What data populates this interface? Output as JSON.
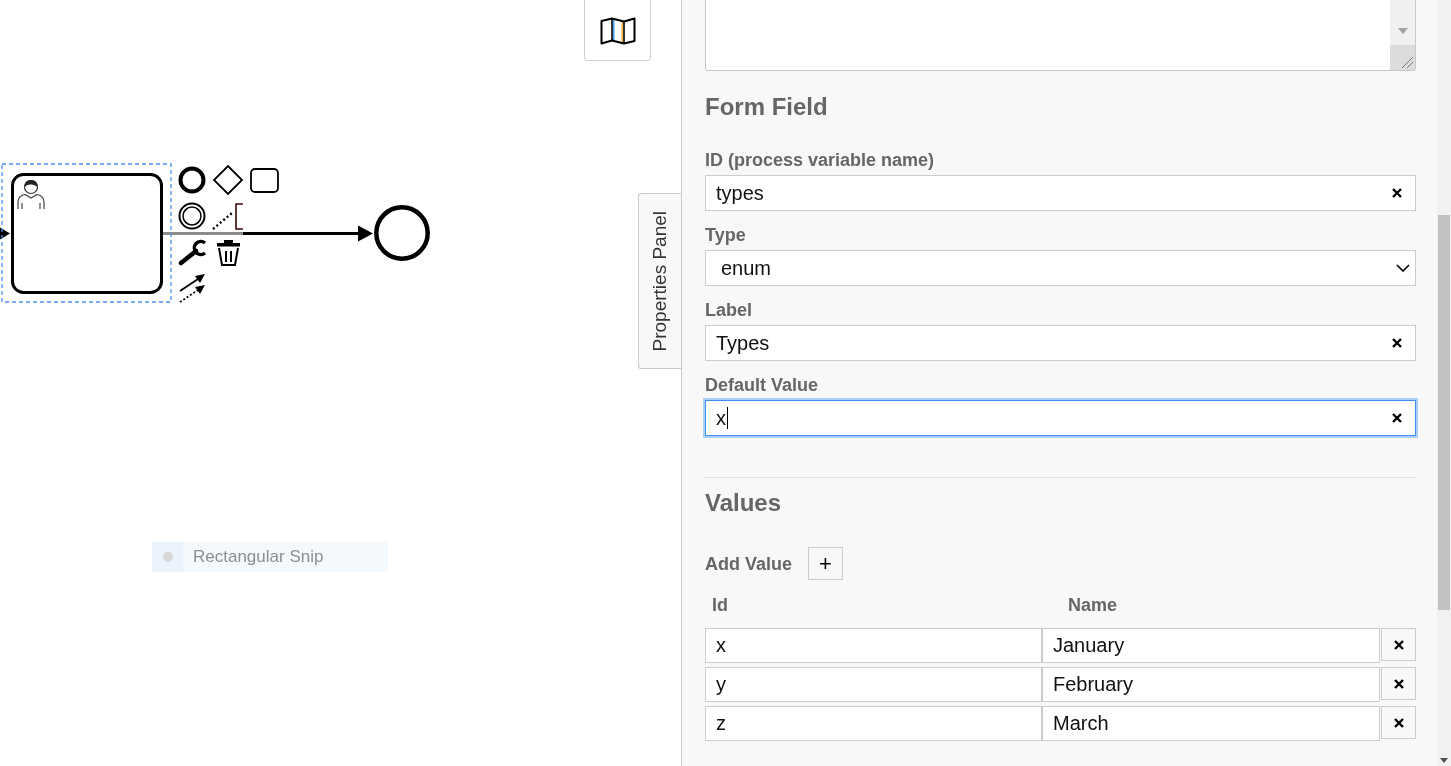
{
  "canvas": {
    "diagram": {
      "elements": [
        {
          "kind": "user-task",
          "selected": true
        },
        {
          "kind": "end-event",
          "selected": false
        }
      ]
    },
    "properties_tab": {
      "label": "Properties Panel"
    },
    "snip_notification": {
      "text": "Rectangular Snip"
    }
  },
  "properties_panel": {
    "form_field": {
      "title": "Form Field",
      "fields": [
        {
          "kind": "text",
          "label": "ID (process variable name)",
          "value": "types",
          "focused": false
        },
        {
          "kind": "select",
          "label": "Type",
          "value": "enum",
          "focused": false
        },
        {
          "kind": "text",
          "label": "Label",
          "value": "Types",
          "focused": false
        },
        {
          "kind": "text",
          "label": "Default Value",
          "value": "x",
          "focused": true
        }
      ]
    },
    "values": {
      "title": "Values",
      "add_label": "Add Value",
      "add_button": "+",
      "columns": [
        "Id",
        "Name"
      ],
      "rows": [
        {
          "id": "x",
          "name": "January"
        },
        {
          "id": "y",
          "name": "February"
        },
        {
          "id": "z",
          "name": "March"
        }
      ]
    }
  }
}
